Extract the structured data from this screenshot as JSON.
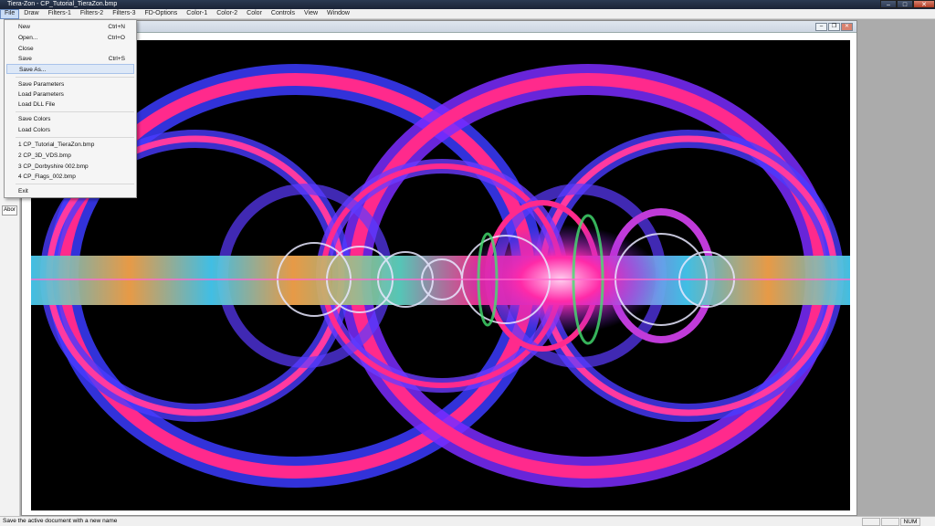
{
  "titlebar": {
    "title": "Tiera-Zon - CP_Tutorial_TieraZon.bmp"
  },
  "menubar": {
    "items": [
      "File",
      "Draw",
      "Filters-1",
      "Filters-2",
      "Filters-3",
      "FD-Options",
      "Color-1",
      "Color-2",
      "Color",
      "Controls",
      "View",
      "Window"
    ]
  },
  "toolbar": {
    "button_label": "Abor"
  },
  "file_menu": {
    "items": [
      {
        "label": "New",
        "shortcut": "Ctrl+N"
      },
      {
        "label": "Open...",
        "shortcut": "Ctrl+O"
      },
      {
        "label": "Close",
        "shortcut": ""
      },
      {
        "label": "Save",
        "shortcut": "Ctrl+S"
      },
      {
        "label": "Save As...",
        "shortcut": ""
      },
      {
        "label": "Save Parameters",
        "shortcut": ""
      },
      {
        "label": "Load Parameters",
        "shortcut": ""
      },
      {
        "label": "Load DLL File",
        "shortcut": ""
      },
      {
        "label": "Save Colors",
        "shortcut": ""
      },
      {
        "label": "Load Colors",
        "shortcut": ""
      },
      {
        "label": "1 CP_Tutorial_TieraZon.bmp",
        "shortcut": ""
      },
      {
        "label": "2 CP_3D_VDS.bmp",
        "shortcut": ""
      },
      {
        "label": "3 CP_Dorbyshire 002.bmp",
        "shortcut": ""
      },
      {
        "label": "4 CP_Flags_002.bmp",
        "shortcut": ""
      },
      {
        "label": "Exit",
        "shortcut": ""
      }
    ]
  },
  "statusbar": {
    "message": "Save the active document with a new name",
    "num": "NUM"
  },
  "colors": {
    "fractal_pink": "#ff2a8c",
    "fractal_violet": "#7a2cff",
    "fractal_blue": "#3b3bff",
    "band_cyan": "#44c8f0",
    "band_orange": "#f3a24a",
    "background": "#000000"
  }
}
